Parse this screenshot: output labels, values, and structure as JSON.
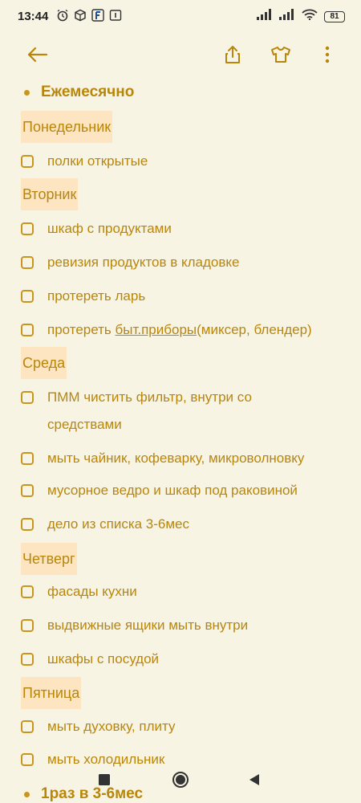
{
  "status": {
    "time": "13:44",
    "battery": "81"
  },
  "toolbar": {
    "back_icon": "arrow-left-icon",
    "share_icon": "share-icon",
    "theme_icon": "tshirt-icon",
    "more_icon": "more-vertical-icon"
  },
  "colors": {
    "background": "#f8f4e4",
    "accent": "#b8860b",
    "highlight": "#fce5c0"
  },
  "sections": [
    {
      "title": "Ежемесячно"
    },
    {
      "title": "1раз в 3-6мес"
    }
  ],
  "days": [
    {
      "label": "Понедельник",
      "tasks": [
        {
          "text": "полки открытые"
        }
      ]
    },
    {
      "label": "Вторник",
      "tasks": [
        {
          "text": "шкаф с продуктами"
        },
        {
          "text": "ревизия продуктов в кладовке"
        },
        {
          "text": "протереть ларь"
        },
        {
          "prefix": "протереть ",
          "link": "быт.приборы",
          "suffix": "(миксер, блендер)"
        }
      ]
    },
    {
      "label": "Среда",
      "tasks": [
        {
          "line1": "ПММ чистить фильтр, внутри со",
          "line2": "средствами"
        },
        {
          "text": "мыть чайник, кофеварку, микроволновку"
        },
        {
          "text": "мусорное ведро и шкаф под раковиной"
        },
        {
          "text": "дело из списка 3-6мес"
        }
      ]
    },
    {
      "label": "Четверг",
      "tasks": [
        {
          "text": "фасады кухни"
        },
        {
          "text": "выдвижные ящики мыть внутри"
        },
        {
          "text": "шкафы с посудой"
        }
      ]
    },
    {
      "label": "Пятница",
      "tasks": [
        {
          "text": "мыть духовку, плиту"
        },
        {
          "text": "мыть холодильник"
        }
      ]
    }
  ]
}
